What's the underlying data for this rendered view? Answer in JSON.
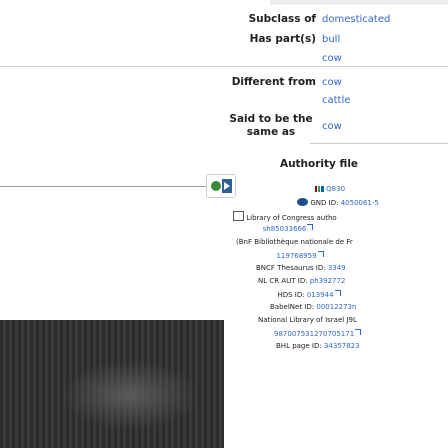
{
  "rows": [
    {
      "label": "Subclass of",
      "values": [
        "domesticated"
      ]
    },
    {
      "label": "Has part(s)",
      "values": [
        "bull",
        "cow"
      ]
    },
    {
      "label": "Different from",
      "values": [
        "cow",
        "cattle"
      ]
    },
    {
      "label_lines": [
        "Said to be the",
        "same as"
      ],
      "values": [
        "cow"
      ]
    }
  ],
  "authority": {
    "header": "Authority file",
    "entries": [
      {
        "prefix": "",
        "text": "Q830"
      },
      {
        "prefix": "GND ID:",
        "text": "4050061-5"
      },
      {
        "prefix": "Library of Congress autho",
        "text": "sh85033666"
      },
      {
        "prefix": "(BnF Bibliothèque nationale de Fr",
        "text": "119768959"
      },
      {
        "prefix": "BNCF Thesaurus ID:",
        "text": "3349"
      },
      {
        "prefix": "NL CR AUT ID:",
        "text": "ph392772"
      },
      {
        "prefix": "HDS ID:",
        "text": "013944"
      },
      {
        "prefix": "BabelNet ID:",
        "text": "00012273n"
      },
      {
        "prefix": "National Library of Israel J9L",
        "text": "987007531270705171"
      },
      {
        "prefix": "BHL page ID:",
        "text": "34357823"
      }
    ]
  },
  "colors": {
    "link": "#3366cc",
    "border": "#c8ccd1",
    "text": "#202122"
  }
}
